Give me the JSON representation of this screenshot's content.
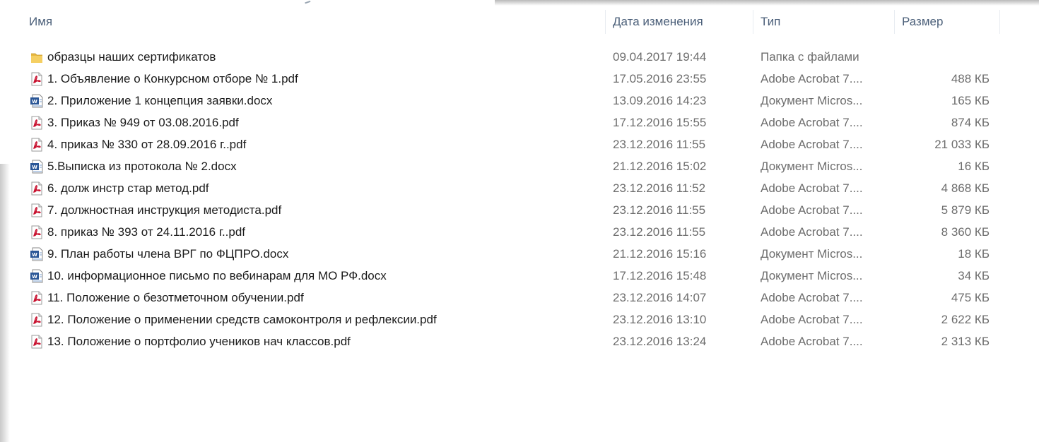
{
  "columns": {
    "name": "Имя",
    "date": "Дата изменения",
    "type": "Тип",
    "size": "Размер"
  },
  "files": [
    {
      "icon": "folder-icon",
      "name": "образцы наших сертификатов",
      "date": "09.04.2017 19:44",
      "type": "Папка с файлами",
      "size": ""
    },
    {
      "icon": "pdf-icon",
      "name": "1. Объявление о Конкурсном отборе № 1.pdf",
      "date": "17.05.2016 23:55",
      "type": "Adobe Acrobat 7....",
      "size": "488 КБ"
    },
    {
      "icon": "word-icon",
      "name": "2. Приложение 1 концепция заявки.docx",
      "date": "13.09.2016 14:23",
      "type": "Документ Micros...",
      "size": "165 КБ"
    },
    {
      "icon": "pdf-icon",
      "name": "3. Приказ № 949 от 03.08.2016.pdf",
      "date": "17.12.2016 15:55",
      "type": "Adobe Acrobat 7....",
      "size": "874 КБ"
    },
    {
      "icon": "pdf-icon",
      "name": "4. приказ № 330 от 28.09.2016 г..pdf",
      "date": "23.12.2016 11:55",
      "type": "Adobe Acrobat 7....",
      "size": "21 033 КБ"
    },
    {
      "icon": "word-icon",
      "name": "5.Выписка из протокола № 2.docx",
      "date": "21.12.2016 15:02",
      "type": "Документ Micros...",
      "size": "16 КБ"
    },
    {
      "icon": "pdf-icon",
      "name": "6. долж инстр стар метод.pdf",
      "date": "23.12.2016 11:52",
      "type": "Adobe Acrobat 7....",
      "size": "4 868 КБ"
    },
    {
      "icon": "pdf-icon",
      "name": "7. должностная инструкция методиста.pdf",
      "date": "23.12.2016 11:55",
      "type": "Adobe Acrobat 7....",
      "size": "5 879 КБ"
    },
    {
      "icon": "pdf-icon",
      "name": "8. приказ № 393 от 24.11.2016 г..pdf",
      "date": "23.12.2016 11:55",
      "type": "Adobe Acrobat 7....",
      "size": "8 360 КБ"
    },
    {
      "icon": "word-icon",
      "name": "9. План работы  члена ВРГ по ФЦПРО.docx",
      "date": "21.12.2016 15:16",
      "type": "Документ Micros...",
      "size": "18 КБ"
    },
    {
      "icon": "word-icon",
      "name": "10. информационное письмо по вебинарам  для МО РФ.docx",
      "date": "17.12.2016 15:48",
      "type": "Документ Micros...",
      "size": "34 КБ"
    },
    {
      "icon": "pdf-icon",
      "name": "11. Положение о безотметочном обучении.pdf",
      "date": "23.12.2016 14:07",
      "type": "Adobe Acrobat 7....",
      "size": "475 КБ"
    },
    {
      "icon": "pdf-icon",
      "name": "12. Положение о применении средств самоконтроля и рефлексии.pdf",
      "date": "23.12.2016 13:10",
      "type": "Adobe Acrobat 7....",
      "size": "2 622 КБ"
    },
    {
      "icon": "pdf-icon",
      "name": "13. Положение о портфолио учеников нач классов.pdf",
      "date": "23.12.2016 13:24",
      "type": "Adobe Acrobat 7....",
      "size": "2 313 КБ"
    }
  ],
  "colors": {
    "header_text": "#4c607a",
    "name_text": "#1b1b1b",
    "meta_text": "#6d6d6d",
    "pdf_red": "#c8102e",
    "word_blue": "#2b5797",
    "folder_yellow": "#e8b840"
  }
}
